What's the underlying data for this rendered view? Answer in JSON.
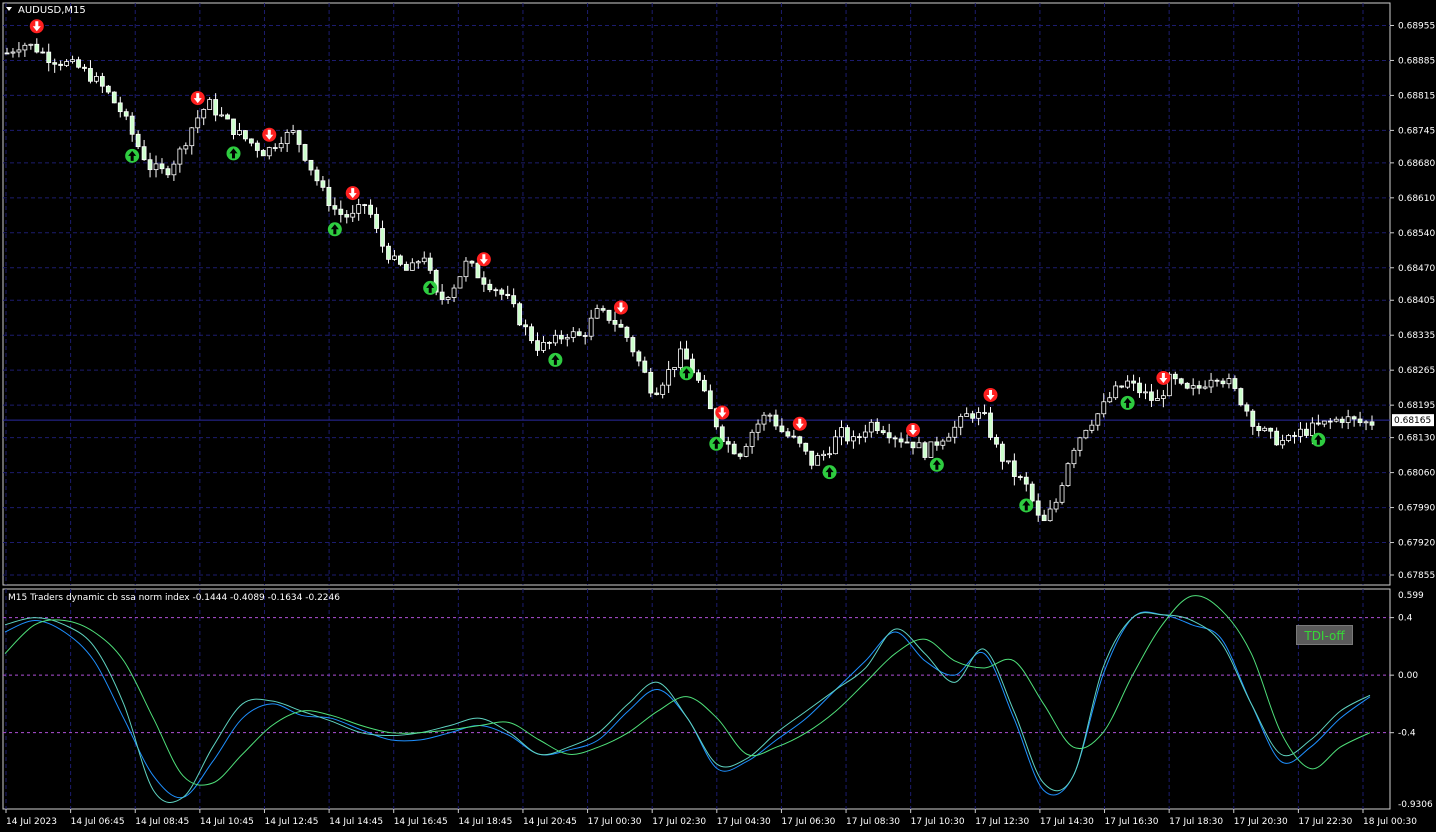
{
  "window": {
    "symbol_title": "AUDUSD,M15",
    "current_price_label": "0.68165"
  },
  "indicator": {
    "title": "M15  Traders dynamic cb ssa norm index -0.1444 -0.4089 -0.1634 -0.2246",
    "button_label": "TDI-off",
    "levels": [
      "0.4",
      "0.00",
      "-0.4"
    ],
    "scale_top": "0.599",
    "scale_bottom": "-0.9306"
  },
  "colors": {
    "background": "#000000",
    "grid": "#1c1c6e",
    "candle": "#ffffff",
    "candle_bull_fill": "#ccffcc",
    "arrow_up": "#2ecc40",
    "arrow_down": "#ff2020",
    "line_blue": "#1e90ff",
    "line_cyan": "#5fd3c0",
    "line_green": "#4fe07a",
    "level_line": "#b050d8",
    "price_line": "#2a2aa0"
  },
  "price_axis": [
    "0.68955",
    "0.68885",
    "0.68815",
    "0.68745",
    "0.68680",
    "0.68610",
    "0.68540",
    "0.68470",
    "0.68405",
    "0.68335",
    "0.68265",
    "0.68195",
    "0.68130",
    "0.68060",
    "0.67990",
    "0.67920",
    "0.67855"
  ],
  "time_axis": [
    "14 Jul 2023",
    "14 Jul 06:45",
    "14 Jul 08:45",
    "14 Jul 10:45",
    "14 Jul 12:45",
    "14 Jul 14:45",
    "14 Jul 16:45",
    "14 Jul 18:45",
    "14 Jul 20:45",
    "17 Jul 00:30",
    "17 Jul 02:30",
    "17 Jul 04:30",
    "17 Jul 06:30",
    "17 Jul 08:30",
    "17 Jul 10:30",
    "17 Jul 12:30",
    "17 Jul 14:30",
    "17 Jul 16:30",
    "17 Jul 18:30",
    "17 Jul 20:30",
    "17 Jul 22:30",
    "18 Jul 00:30"
  ],
  "chart_data": {
    "type": "candlestick",
    "symbol": "AUDUSD",
    "timeframe": "M15",
    "ylim": [
      0.67835,
      0.69
    ],
    "current_price": 0.68165,
    "price_series": [
      0.689,
      0.6892,
      0.6891,
      0.6889,
      0.6888,
      0.6887,
      0.6885,
      0.6882,
      0.6878,
      0.6872,
      0.6867,
      0.6866,
      0.687,
      0.6876,
      0.688,
      0.6877,
      0.6874,
      0.6872,
      0.687,
      0.6873,
      0.6874,
      0.6868,
      0.6862,
      0.6858,
      0.6857,
      0.686,
      0.6852,
      0.6848,
      0.6846,
      0.685,
      0.684,
      0.6843,
      0.6848,
      0.6845,
      0.6843,
      0.684,
      0.6835,
      0.6831,
      0.6832,
      0.6834,
      0.6833,
      0.6838,
      0.6837,
      0.6834,
      0.6828,
      0.6822,
      0.6826,
      0.683,
      0.6825,
      0.6818,
      0.6812,
      0.681,
      0.6815,
      0.6818,
      0.6814,
      0.6812,
      0.6808,
      0.681,
      0.6814,
      0.6812,
      0.6816,
      0.6815,
      0.6813,
      0.6812,
      0.681,
      0.6813,
      0.6815,
      0.6818,
      0.6817,
      0.681,
      0.6806,
      0.6803,
      0.6795,
      0.68,
      0.681,
      0.6815,
      0.6818,
      0.6822,
      0.6824,
      0.6822,
      0.682,
      0.6825,
      0.6822,
      0.6823,
      0.6826,
      0.6824,
      0.682,
      0.6815,
      0.6813,
      0.6812,
      0.6814,
      0.6815,
      0.6816,
      0.6817,
      0.6816,
      0.6816
    ],
    "indicator_ylim": [
      -0.9306,
      0.599
    ],
    "series": [
      {
        "values": [
          0.3,
          0.38,
          0.3,
          0.1,
          -0.3,
          -0.7,
          -0.85,
          -0.6,
          -0.3,
          -0.2,
          -0.28,
          -0.3,
          -0.38,
          -0.45,
          -0.45,
          -0.4,
          -0.35,
          -0.42,
          -0.55,
          -0.52,
          -0.45,
          -0.25,
          -0.1,
          -0.3,
          -0.65,
          -0.6,
          -0.45,
          -0.3,
          -0.1,
          0.1,
          0.3,
          0.1,
          0.0,
          0.15,
          -0.3,
          -0.8,
          -0.7,
          0.0,
          0.4,
          0.42,
          0.35,
          0.25,
          -0.2,
          -0.6,
          -0.5,
          -0.3,
          -0.15
        ]
      },
      {
        "values": [
          0.35,
          0.4,
          0.35,
          0.2,
          -0.2,
          -0.8,
          -0.85,
          -0.5,
          -0.2,
          -0.18,
          -0.25,
          -0.32,
          -0.4,
          -0.42,
          -0.4,
          -0.35,
          -0.3,
          -0.4,
          -0.55,
          -0.5,
          -0.4,
          -0.2,
          -0.05,
          -0.3,
          -0.62,
          -0.58,
          -0.4,
          -0.25,
          -0.1,
          0.05,
          0.32,
          0.15,
          -0.05,
          0.18,
          -0.25,
          -0.75,
          -0.7,
          0.05,
          0.4,
          0.42,
          0.38,
          0.22,
          -0.2,
          -0.55,
          -0.45,
          -0.25,
          -0.14
        ]
      },
      {
        "values": [
          0.15,
          0.35,
          0.38,
          0.3,
          0.1,
          -0.3,
          -0.7,
          -0.75,
          -0.55,
          -0.35,
          -0.25,
          -0.28,
          -0.35,
          -0.4,
          -0.4,
          -0.38,
          -0.35,
          -0.33,
          -0.45,
          -0.55,
          -0.5,
          -0.4,
          -0.25,
          -0.15,
          -0.3,
          -0.55,
          -0.5,
          -0.4,
          -0.25,
          -0.05,
          0.15,
          0.25,
          0.1,
          0.05,
          0.1,
          -0.2,
          -0.5,
          -0.4,
          0.0,
          0.35,
          0.55,
          0.45,
          0.15,
          -0.4,
          -0.65,
          -0.5,
          -0.4
        ]
      }
    ]
  }
}
